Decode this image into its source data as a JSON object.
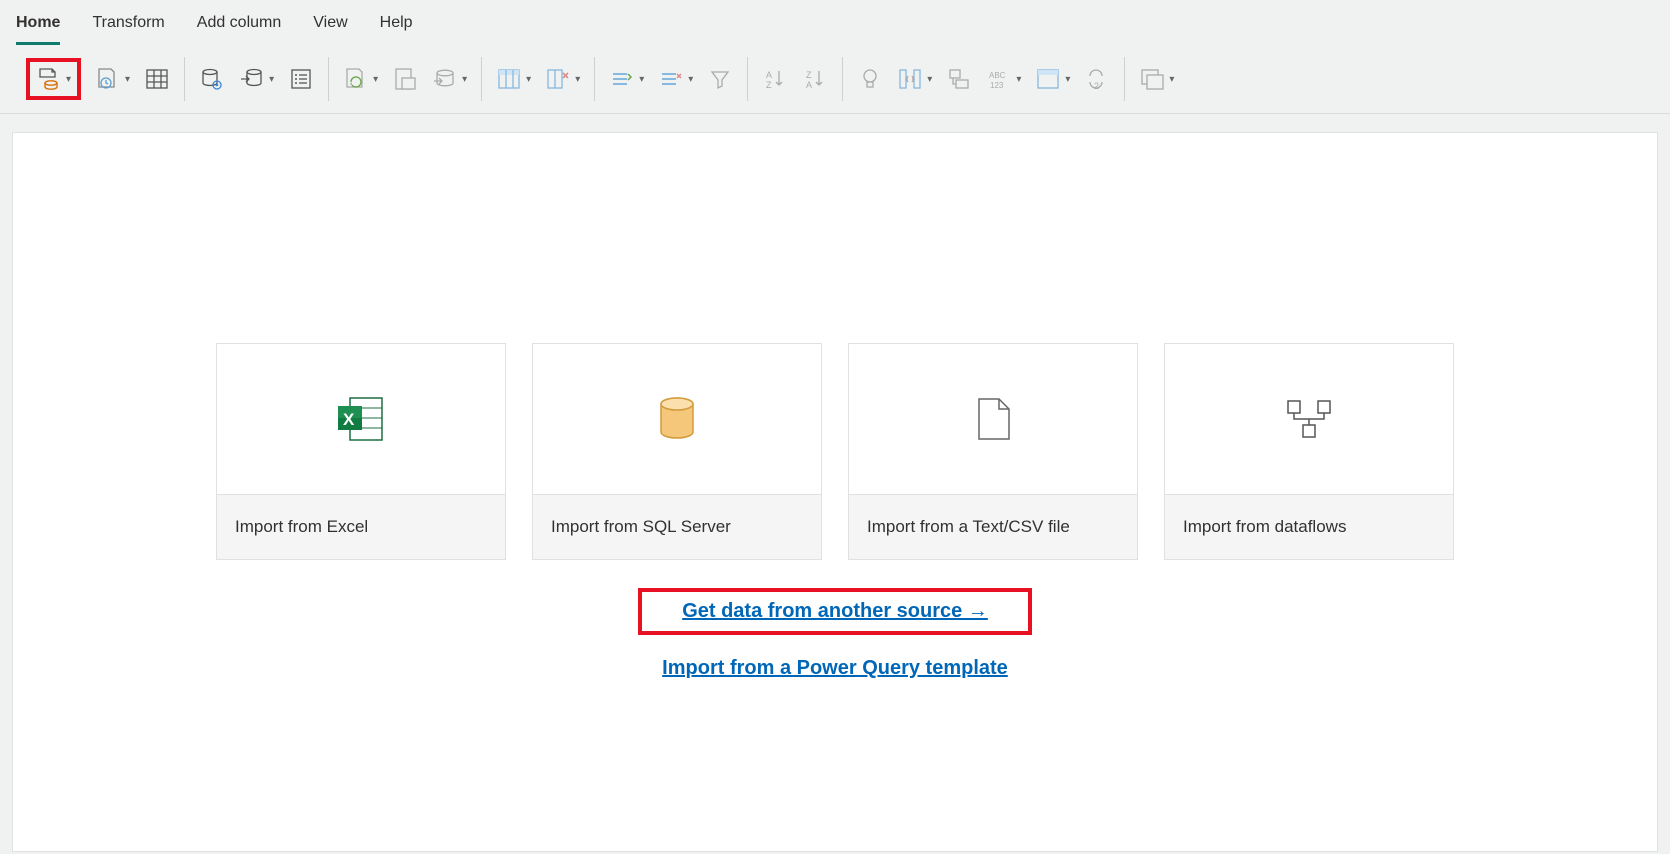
{
  "tabs": {
    "home": "Home",
    "transform": "Transform",
    "add_column": "Add column",
    "view": "View",
    "help": "Help"
  },
  "cards": {
    "excel": "Import from Excel",
    "sql": "Import from SQL Server",
    "textcsv": "Import from a Text/CSV file",
    "dataflows": "Import from dataflows"
  },
  "links": {
    "another_source": "Get data from another source →",
    "pq_template": "Import from a Power Query template"
  }
}
